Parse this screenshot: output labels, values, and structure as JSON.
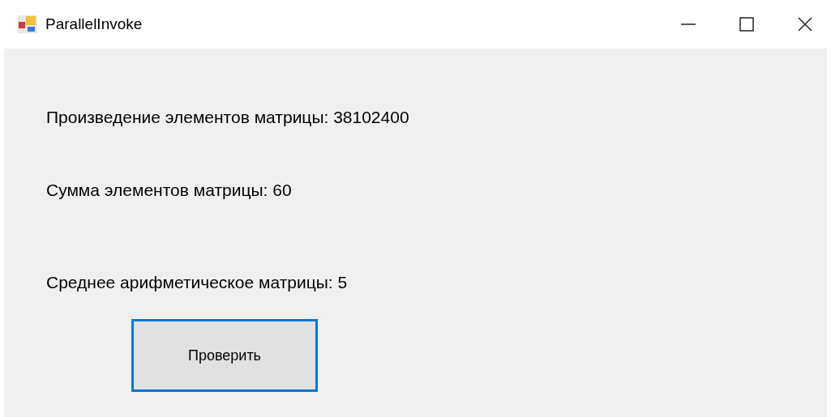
{
  "window": {
    "title": "ParallelInvoke"
  },
  "labels": [
    "Произведение элементов матрицы: 38102400",
    "Сумма элементов матрицы: 60",
    "Среднее арифметическое матрицы: 5"
  ],
  "button": {
    "label": "Проверить",
    "focused": true
  }
}
